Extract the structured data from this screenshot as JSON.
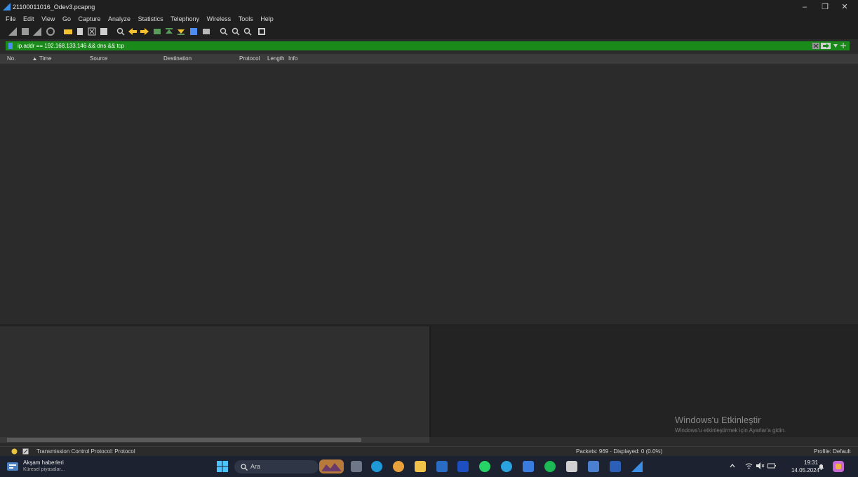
{
  "window": {
    "title": "21100011016_Odev3.pcapng",
    "minimize": "–",
    "restore": "❐",
    "close": "✕"
  },
  "menu": [
    "File",
    "Edit",
    "View",
    "Go",
    "Capture",
    "Analyze",
    "Statistics",
    "Telephony",
    "Wireless",
    "Tools",
    "Help"
  ],
  "filter": {
    "value": "ip.addr == 192.168.133.146 && dns && tcp",
    "color": "#1a8a1a"
  },
  "columns": {
    "no": "No.",
    "time": "Time",
    "source": "Source",
    "destination": "Destination",
    "protocol": "Protocol",
    "length": "Length",
    "info": "Info"
  },
  "status": {
    "field": "Transmission Control Protocol: Protocol",
    "packets": "Packets: 969 · Displayed: 0 (0.0%)",
    "profile": "Profile: Default"
  },
  "watermark": {
    "line1": "Windows'u Etkinleştir",
    "line2": "Windows'u etkinleştirmek için Ayarlar'a gidin."
  },
  "taskbar": {
    "news_title": "Akşam haberleri",
    "news_sub": "Küresel piyasalar...",
    "search_placeholder": "Ara",
    "time": "19:31",
    "date": "14.05.2024"
  }
}
